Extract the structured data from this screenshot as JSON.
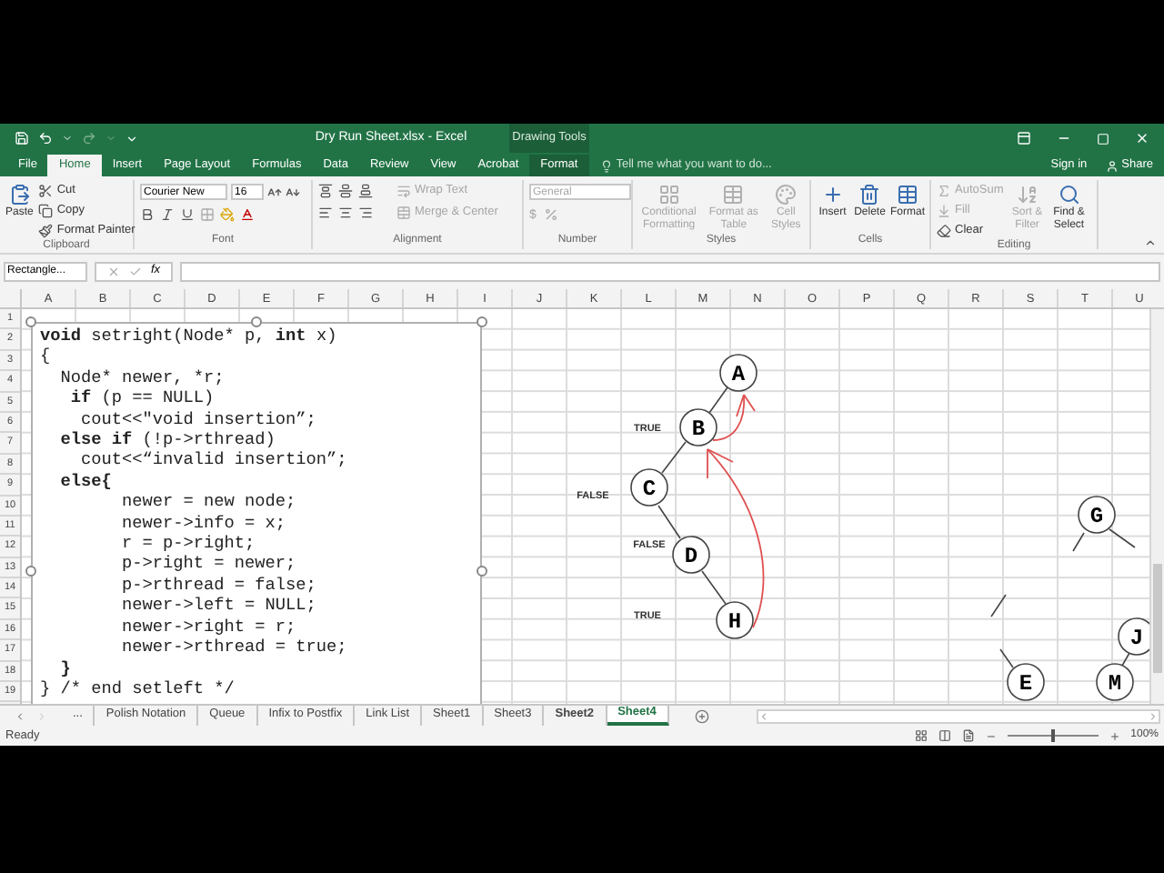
{
  "title_bar": {
    "title": "Dry Run Sheet.xlsx - Excel",
    "context_label": "Drawing Tools"
  },
  "ribbon_tabs": [
    {
      "label": "File",
      "selected": false,
      "kind": "normal"
    },
    {
      "label": "Home",
      "selected": true,
      "kind": "normal"
    },
    {
      "label": "Insert",
      "selected": false,
      "kind": "normal"
    },
    {
      "label": "Page Layout",
      "selected": false,
      "kind": "normal"
    },
    {
      "label": "Formulas",
      "selected": false,
      "kind": "normal"
    },
    {
      "label": "Data",
      "selected": false,
      "kind": "normal"
    },
    {
      "label": "Review",
      "selected": false,
      "kind": "normal"
    },
    {
      "label": "View",
      "selected": false,
      "kind": "normal"
    },
    {
      "label": "Acrobat",
      "selected": false,
      "kind": "normal"
    },
    {
      "label": "Format",
      "selected": false,
      "kind": "contextual"
    }
  ],
  "tell_me": {
    "placeholder": "Tell me what you want to do..."
  },
  "account": {
    "sign_in": "Sign in",
    "share": "Share"
  },
  "ribbon": {
    "clipboard": {
      "label": "Clipboard",
      "paste": "Paste",
      "items": [
        {
          "label": "Cut",
          "disabled": false
        },
        {
          "label": "Copy",
          "disabled": false
        },
        {
          "label": "Format Painter",
          "disabled": false
        }
      ]
    },
    "font": {
      "label": "Font",
      "font_name": "Courier New",
      "font_size": "16"
    },
    "alignment": {
      "label": "Alignment",
      "items": [
        {
          "label": "Wrap Text",
          "disabled": true
        },
        {
          "label": "Merge & Center",
          "disabled": true
        }
      ]
    },
    "number": {
      "label": "Number",
      "format": "General",
      "currency": "$",
      "disabled": true
    },
    "styles": {
      "label": "Styles",
      "items": [
        {
          "label": "Conditional Formatting",
          "disabled": true
        },
        {
          "label": "Format as Table",
          "disabled": true
        },
        {
          "label": "Cell Styles",
          "disabled": true
        }
      ]
    },
    "cells": {
      "label": "Cells",
      "items": [
        {
          "label": "Insert",
          "disabled": false
        },
        {
          "label": "Delete",
          "disabled": false
        },
        {
          "label": "Format",
          "disabled": false
        }
      ]
    },
    "editing": {
      "label": "Editing",
      "items": [
        {
          "label": "AutoSum",
          "disabled": true
        },
        {
          "label": "Fill",
          "disabled": true
        },
        {
          "label": "Clear",
          "disabled": false
        }
      ],
      "large": [
        {
          "label": "Sort & Filter",
          "disabled": true
        },
        {
          "label": "Find & Select",
          "disabled": false
        }
      ]
    }
  },
  "formula_bar": {
    "name_box": "Rectangle...",
    "function_label": "fx"
  },
  "columns": [
    "A",
    "B",
    "C",
    "D",
    "E",
    "F",
    "G",
    "H",
    "I",
    "J",
    "K",
    "L",
    "M",
    "N",
    "O",
    "P",
    "Q",
    "R",
    "S",
    "T",
    "U"
  ],
  "rows": [
    "1",
    "2",
    "3",
    "4",
    "5",
    "6",
    "7",
    "8",
    "9",
    "10",
    "11",
    "12",
    "13",
    "14",
    "15",
    "16",
    "17",
    "18",
    "19"
  ],
  "code_lines": [
    "**void** setright(Node* p, **int** x)",
    "{",
    "  Node* newer, *r;",
    "   **if** (p == NULL)",
    "    cout<<\"void insertion”;",
    "  **else if** (!p->rthread)",
    "    cout<<“invalid insertion”;",
    "  **else{**",
    "        newer = new node;",
    "        newer->info = x;",
    "        r = p->right;",
    "        p->right = newer;",
    "        p->rthread = false;",
    "        newer->left = NULL;",
    "        newer->right = r;",
    "        newer->rthread = true;",
    "  **}**",
    "} /* end setleft */"
  ],
  "tree_nodes": [
    {
      "label": "A"
    },
    {
      "label": "B"
    },
    {
      "label": "C"
    },
    {
      "label": "D"
    },
    {
      "label": "H"
    },
    {
      "label": "G"
    },
    {
      "label": "J"
    },
    {
      "label": "M"
    },
    {
      "label": "E"
    }
  ],
  "thread_flags": [
    "TRUE",
    "FALSE",
    "FALSE",
    "TRUE"
  ],
  "sheet_tabs": [
    {
      "label": "...",
      "selected": false,
      "bold": false
    },
    {
      "label": "Polish Notation",
      "selected": false,
      "bold": false
    },
    {
      "label": "Queue",
      "selected": false,
      "bold": false
    },
    {
      "label": "Infix to Postfix",
      "selected": false,
      "bold": false
    },
    {
      "label": "Link List",
      "selected": false,
      "bold": false
    },
    {
      "label": "Sheet1",
      "selected": false,
      "bold": false
    },
    {
      "label": "Sheet3",
      "selected": false,
      "bold": false
    },
    {
      "label": "Sheet2",
      "selected": false,
      "bold": true
    },
    {
      "label": "Sheet4",
      "selected": true,
      "bold": false
    }
  ],
  "status_bar": {
    "text": "Ready",
    "zoom": {
      "level": 0.5,
      "reading": "100%"
    }
  }
}
